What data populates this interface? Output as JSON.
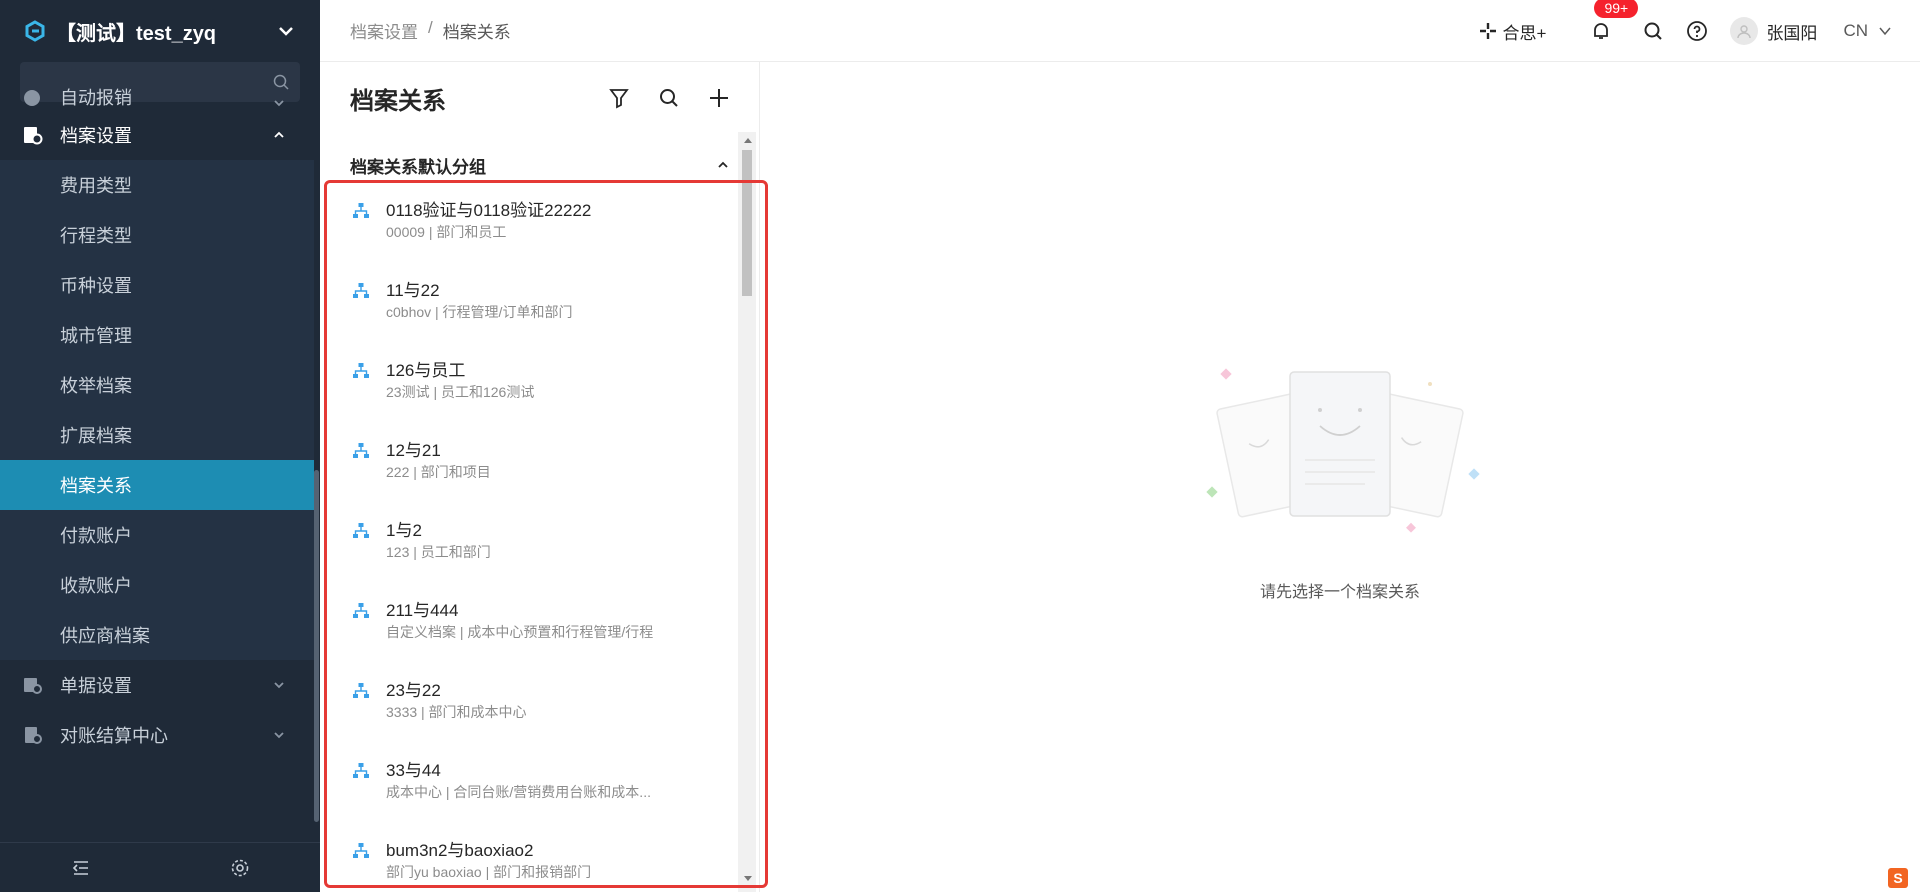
{
  "sidebar": {
    "org_name": "【测试】test_zyq",
    "search_placeholder": "",
    "menu_top_partial": "自动报销",
    "menu": [
      {
        "label": "档案设置",
        "expanded": true
      }
    ],
    "sub_items": [
      {
        "label": "费用类型"
      },
      {
        "label": "行程类型"
      },
      {
        "label": "币种设置"
      },
      {
        "label": "城市管理"
      },
      {
        "label": "枚举档案"
      },
      {
        "label": "扩展档案"
      },
      {
        "label": "档案关系",
        "active": true
      },
      {
        "label": "付款账户"
      },
      {
        "label": "收款账户"
      },
      {
        "label": "供应商档案"
      }
    ],
    "menu_after": [
      {
        "label": "单据设置"
      },
      {
        "label": "对账结算中心"
      }
    ]
  },
  "topbar": {
    "breadcrumb": [
      "档案设置",
      "/",
      "档案关系"
    ],
    "hesi_label": "合思+",
    "notif_badge": "99+",
    "user_name": "张国阳",
    "language": "CN"
  },
  "list_panel": {
    "title": "档案关系",
    "group_title": "档案关系默认分组",
    "items": [
      {
        "title": "0118验证与0118验证22222",
        "subtitle": "00009 | 部门和员工"
      },
      {
        "title": "11与22",
        "subtitle": "c0bhov | 行程管理/订单和部门"
      },
      {
        "title": "126与员工",
        "subtitle": "23测试 | 员工和126测试"
      },
      {
        "title": "12与21",
        "subtitle": "222 | 部门和项目"
      },
      {
        "title": "1与2",
        "subtitle": "123 | 员工和部门"
      },
      {
        "title": "211与444",
        "subtitle": "自定义档案 | 成本中心预置和行程管理/行程"
      },
      {
        "title": "23与22",
        "subtitle": "3333 | 部门和成本中心"
      },
      {
        "title": "33与44",
        "subtitle": "成本中心 | 合同台账/营销费用台账和成本..."
      },
      {
        "title": "bum3n2与baoxiao2",
        "subtitle": "部门yu baoxiao | 部门和报销部门"
      }
    ]
  },
  "empty_state": {
    "message": "请先选择一个档案关系"
  },
  "colors": {
    "sidebar_bg": "#1f2a38",
    "active_bg": "#1d8db3",
    "accent_icon": "#3aa0e8",
    "highlight_border": "#e53935",
    "badge": "#f5222d"
  }
}
